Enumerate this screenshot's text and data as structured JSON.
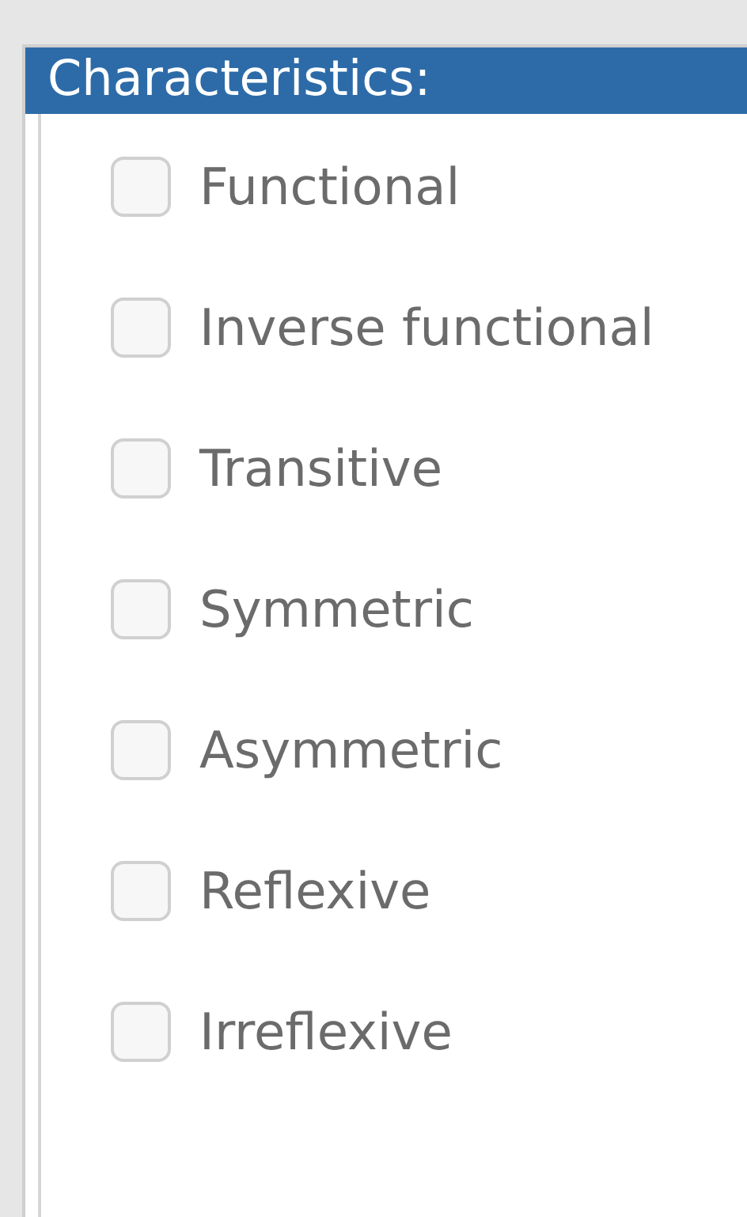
{
  "header": {
    "title": "Characteristics:"
  },
  "characteristics": [
    {
      "label": "Functional",
      "checked": false
    },
    {
      "label": "Inverse functional",
      "checked": false
    },
    {
      "label": "Transitive",
      "checked": false
    },
    {
      "label": "Symmetric",
      "checked": false
    },
    {
      "label": "Asymmetric",
      "checked": false
    },
    {
      "label": "Reflexive",
      "checked": false
    },
    {
      "label": "Irreflexive",
      "checked": false
    }
  ]
}
